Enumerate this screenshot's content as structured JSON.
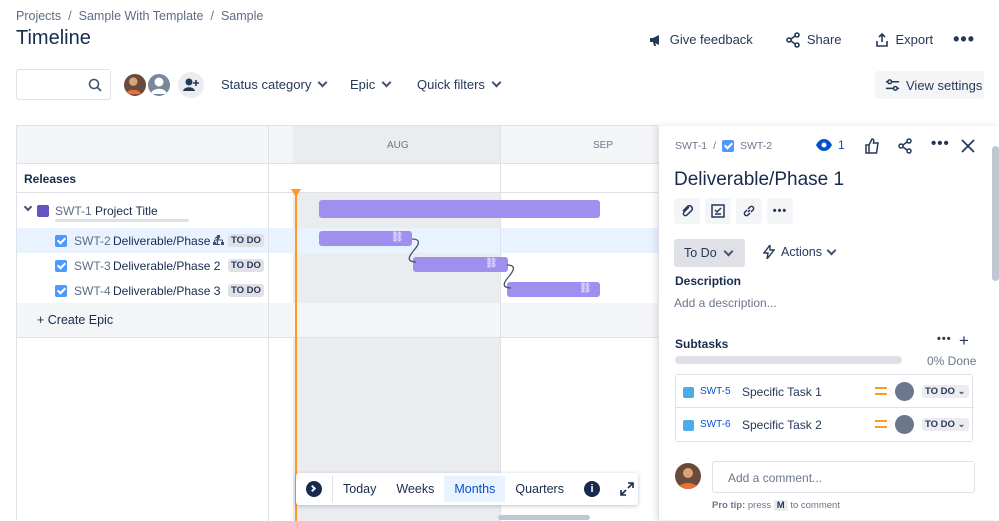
{
  "breadcrumb": [
    "Projects",
    "Sample With Template",
    "Sample"
  ],
  "page_title": "Timeline",
  "header_actions": {
    "feedback": "Give feedback",
    "share": "Share",
    "export": "Export"
  },
  "toolbar": {
    "search_placeholder": "",
    "filters": [
      "Status category",
      "Epic",
      "Quick filters"
    ],
    "view_settings": "View settings"
  },
  "timeline": {
    "months": [
      "AUG",
      "SEP"
    ],
    "releases_label": "Releases",
    "epic": {
      "key": "SWT-1",
      "title": "Project Title"
    },
    "issues": [
      {
        "key": "SWT-2",
        "title": "Deliverable/Phase 1",
        "status": "TO DO"
      },
      {
        "key": "SWT-3",
        "title": "Deliverable/Phase 2",
        "status": "TO DO"
      },
      {
        "key": "SWT-4",
        "title": "Deliverable/Phase 3",
        "status": "TO DO"
      }
    ],
    "create_epic": "Create Epic",
    "zoom": {
      "today": "Today",
      "weeks": "Weeks",
      "months": "Months",
      "quarters": "Quarters",
      "active": "Months"
    }
  },
  "panel": {
    "parent_key": "SWT-1",
    "issue_key": "SWT-2",
    "watchers": "1",
    "title": "Deliverable/Phase 1",
    "status": "To Do",
    "actions": "Actions",
    "description_label": "Description",
    "description_placeholder": "Add a description...",
    "subtasks_label": "Subtasks",
    "progress_text": "0% Done",
    "progress": 0,
    "subtasks": [
      {
        "key": "SWT-5",
        "title": "Specific Task 1",
        "status": "TO DO"
      },
      {
        "key": "SWT-6",
        "title": "Specific Task 2",
        "status": "TO DO"
      }
    ],
    "comment_placeholder": "Add a comment...",
    "tip_prefix": "Pro tip:",
    "tip_press": "press",
    "tip_key": "M",
    "tip_suffix": "to comment"
  },
  "colors": {
    "accent": "#0052cc",
    "bar": "#9f8fef",
    "today_line": "#ff991f",
    "selected_row": "#e9f2ff"
  }
}
